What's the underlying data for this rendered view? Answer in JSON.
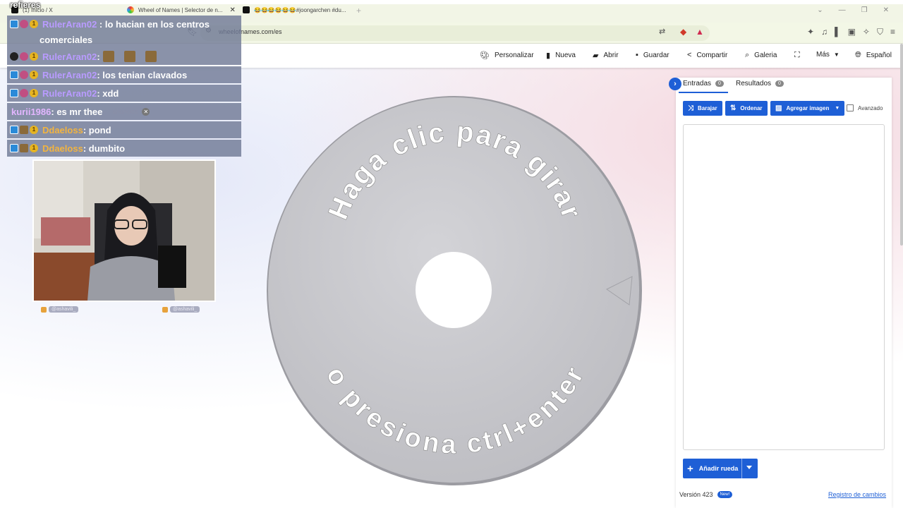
{
  "browser": {
    "tabs": [
      {
        "label": "(1) Inicio / X",
        "icon": "x-icon"
      },
      {
        "label": "Wheel of Names | Selector de n...",
        "icon": "wheel-icon"
      },
      {
        "label": "😂😂😂😂😂😂#joongarchen #du...",
        "icon": "tiktok-icon"
      }
    ],
    "url": "wheelofnames.com/es"
  },
  "nav": {
    "items": [
      {
        "label": "Personalizar",
        "icon": "palette-icon"
      },
      {
        "label": "Nueva",
        "icon": "file-icon"
      },
      {
        "label": "Abrir",
        "icon": "folder-icon"
      },
      {
        "label": "Guardar",
        "icon": "save-icon"
      },
      {
        "label": "Compartir",
        "icon": "share-icon"
      },
      {
        "label": "Galeria",
        "icon": "search-icon"
      },
      {
        "label": "",
        "icon": "fullscreen-icon"
      },
      {
        "label": "Más",
        "icon": "caret-down-icon"
      },
      {
        "label": "Español",
        "icon": "globe-icon"
      }
    ]
  },
  "wheel": {
    "top_text": "Haga clic para girar",
    "bottom_text": "o presiona ctrl+enter",
    "colors": {
      "fill": "#c9c9cd",
      "rim": "#a9a9ae",
      "hub": "#ffffff",
      "pointer": "#c2c2c6"
    }
  },
  "panel": {
    "tabs": [
      {
        "label": "Entradas",
        "count": "0"
      },
      {
        "label": "Resultados",
        "count": "0"
      }
    ],
    "buttons": {
      "shuffle": "Barajar",
      "sort": "Ordenar",
      "add_image": "Agregar imagen",
      "advanced": "Avanzado"
    },
    "add_wheel": "Añadir rueda",
    "version": "Versión 423",
    "new_badge": "New!",
    "changelog": "Registro de cambios",
    "accent": "#1e5fd6"
  },
  "chat": {
    "top_line": "refieres",
    "messages": [
      {
        "user": "RulerAran02",
        "text": " : lo hacian en los centros comerciales",
        "color": "purple"
      },
      {
        "user": "RulerAran02",
        "text": " : ",
        "color": "purple"
      },
      {
        "user": "RulerAran02",
        "text": " : los tenian clavados",
        "color": "purple"
      },
      {
        "user": "RulerAran02",
        "text": " : xdd",
        "color": "purple"
      },
      {
        "user": "kurii1986",
        "text": " : es mr thee",
        "color": "pink"
      },
      {
        "user": "Ddaeloss",
        "text": " : pond",
        "color": "orange"
      },
      {
        "user": "Ddaeloss",
        "text": " : dumbito",
        "color": "orange"
      }
    ],
    "ads_text": "anuncios"
  },
  "webcam": {
    "socials": [
      {
        "handle": "@ashavili_",
        "icon": "instagram-icon"
      },
      {
        "handle": "@ashavili_",
        "icon": "twitter-icon"
      }
    ]
  }
}
